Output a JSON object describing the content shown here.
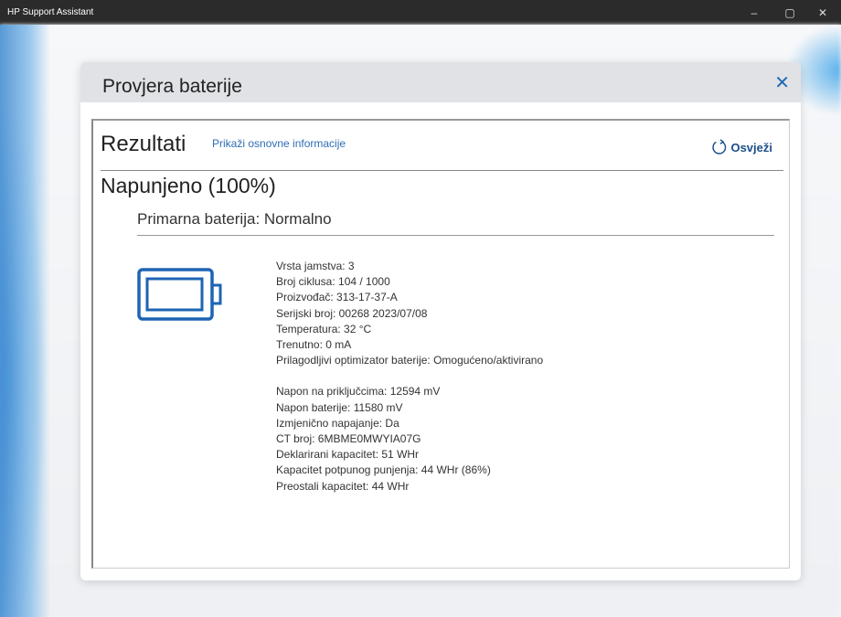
{
  "app": {
    "title": "HP Support Assistant",
    "minimize": "–",
    "maximize": "▢",
    "close": "✕"
  },
  "modal": {
    "title": "Provjera baterije",
    "close": "✕"
  },
  "results": {
    "heading": "Rezultati",
    "link": "Prikaži osnovne informacije",
    "refresh": "Osvježi",
    "charge_status": "Napunjeno (100%)",
    "battery_status": "Primarna baterija: Normalno"
  },
  "details_group1": [
    "Vrsta jamstva: 3",
    "Broj ciklusa: 104 / 1000",
    "Proizvođač: 313-17-37-A",
    "Serijski broj: 00268 2023/07/08",
    "Temperatura: 32 °C",
    "Trenutno: 0 mA",
    "Prilagodljivi optimizator baterije: Omogućeno/aktivirano"
  ],
  "details_group2": [
    "Napon na priključcima: 12594 mV",
    "Napon baterije: 11580 mV",
    "Izmjenično napajanje: Da",
    "CT broj: 6MBME0MWYIA07G",
    "Deklarirani kapacitet: 51 WHr",
    "Kapacitet potpunog punjenja: 44 WHr (86%)",
    "Preostali kapacitet: 44 WHr"
  ],
  "colors": {
    "accent": "#1f6bb5",
    "battery": "#1e64b4"
  }
}
